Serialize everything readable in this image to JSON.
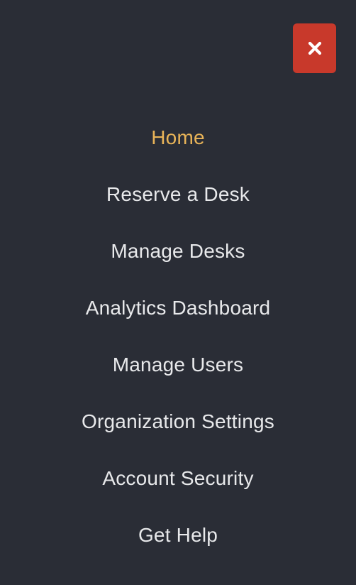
{
  "colors": {
    "background": "#2a2d36",
    "close_button": "#c8392b",
    "active_text": "#e9b458",
    "text": "#e8e9eb"
  },
  "close_button": {
    "icon": "close-icon"
  },
  "menu": {
    "items": [
      {
        "label": "Home",
        "active": true
      },
      {
        "label": "Reserve a Desk",
        "active": false
      },
      {
        "label": "Manage Desks",
        "active": false
      },
      {
        "label": "Analytics Dashboard",
        "active": false
      },
      {
        "label": "Manage Users",
        "active": false
      },
      {
        "label": "Organization Settings",
        "active": false
      },
      {
        "label": "Account Security",
        "active": false
      },
      {
        "label": "Get Help",
        "active": false
      }
    ]
  }
}
